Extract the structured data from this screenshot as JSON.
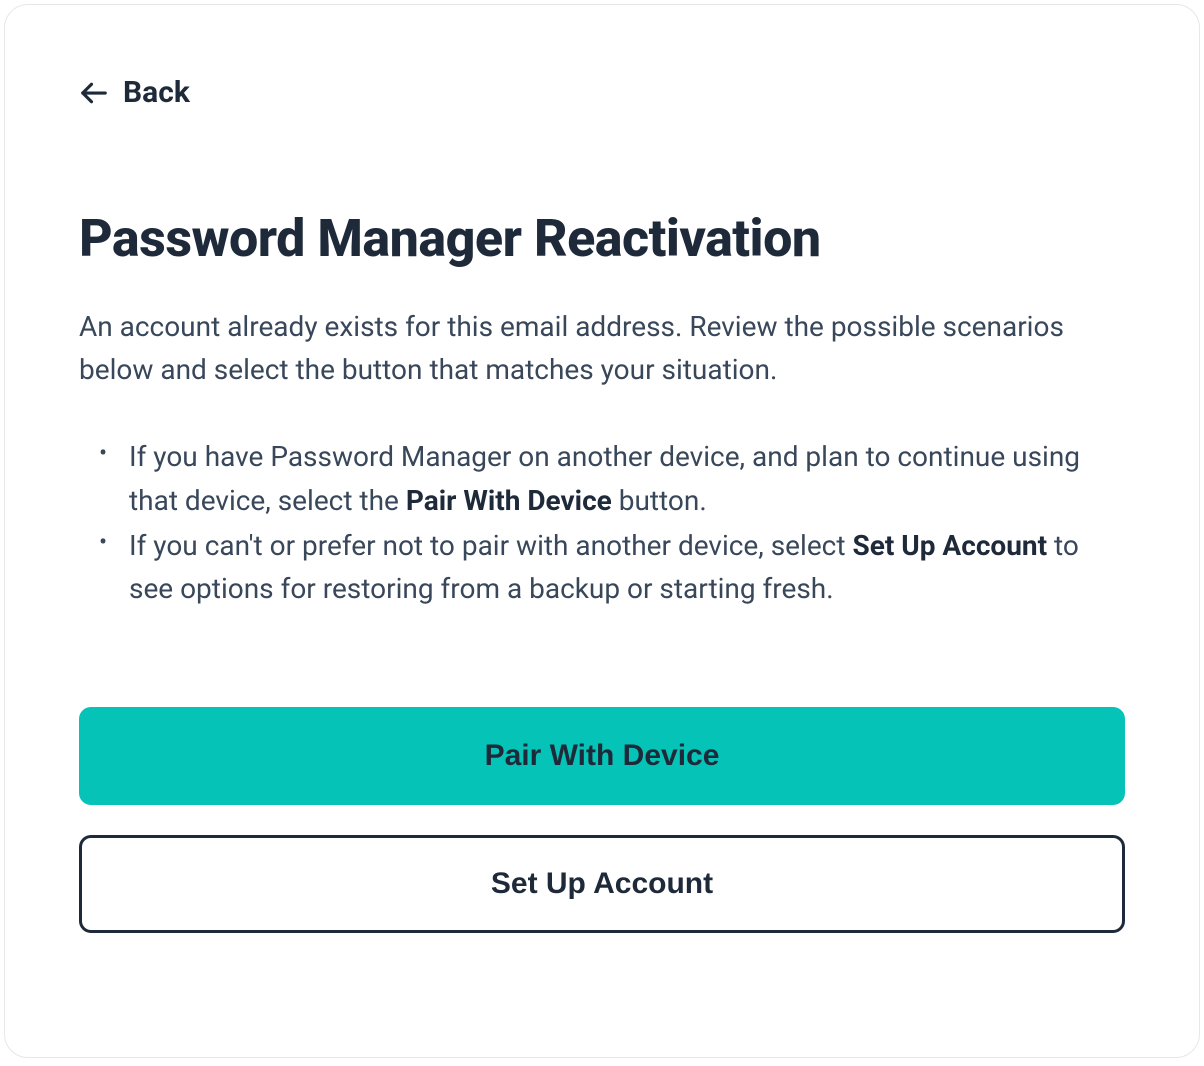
{
  "back": {
    "label": "Back"
  },
  "title": "Password Manager Reactivation",
  "description": "An account already exists for this email address. Review the possible scenarios below and select the button that matches your situation.",
  "bullets": [
    {
      "pre": "If you have Password Manager on another device, and plan to continue using that device, select the ",
      "bold": "Pair With Device",
      "post": " button."
    },
    {
      "pre": "If you can't or prefer not to pair with another device, select ",
      "bold": "Set Up Account",
      "post": " to see options for restoring from a backup or starting fresh."
    }
  ],
  "buttons": {
    "primary": "Pair With Device",
    "secondary": "Set Up Account"
  }
}
